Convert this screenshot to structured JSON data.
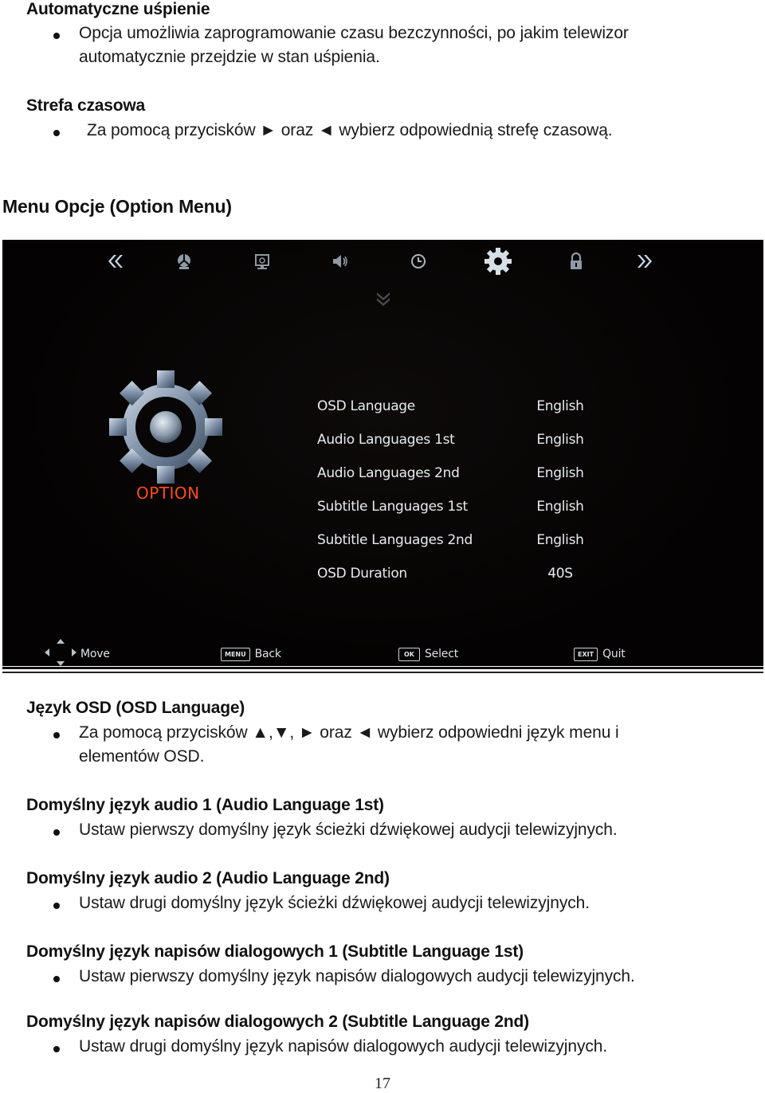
{
  "sections_top": [
    {
      "heading": "Automatyczne uśpienie",
      "bullets": [
        [
          "Opcja umożliwia zaprogramowanie czasu bezczynności, po jakim telewizor",
          "automatycznie przejdzie w stan uśpienia."
        ]
      ]
    },
    {
      "heading": "Strefa czasowa",
      "bullets": [
        [
          "Za pomocą przycisków ► oraz ◄ wybierz odpowiednią strefę czasową."
        ]
      ]
    }
  ],
  "menu_section_heading": "Menu Opcje (Option Menu)",
  "tv_screen": {
    "top_icons": [
      {
        "name": "prev-page",
        "glyph": "double-chevron-left-icon",
        "active": false
      },
      {
        "name": "channel",
        "glyph": "satellite-icon",
        "active": false
      },
      {
        "name": "picture",
        "glyph": "monitor-icon",
        "active": false
      },
      {
        "name": "sound",
        "glyph": "speaker-icon",
        "active": false
      },
      {
        "name": "time",
        "glyph": "clock-icon",
        "active": false
      },
      {
        "name": "option",
        "glyph": "gear-icon",
        "active": true
      },
      {
        "name": "lock",
        "glyph": "lock-icon",
        "active": false
      },
      {
        "name": "next-page",
        "glyph": "double-chevron-right-icon",
        "active": false
      }
    ],
    "section_label": "OPTION",
    "menu_items": [
      {
        "label": "OSD Language",
        "value": "English"
      },
      {
        "label": "Audio Languages 1st",
        "value": "English"
      },
      {
        "label": "Audio Languages 2nd",
        "value": "English"
      },
      {
        "label": "Subtitle Languages 1st",
        "value": "English"
      },
      {
        "label": "Subtitle Languages 2nd",
        "value": "English"
      },
      {
        "label": "OSD Duration",
        "value": "40S"
      }
    ],
    "hints": [
      {
        "key": "",
        "label": "Move"
      },
      {
        "key": "MENU",
        "label": "Back"
      },
      {
        "key": "OK",
        "label": "Select"
      },
      {
        "key": "EXIT",
        "label": "Quit"
      }
    ],
    "colors": {
      "background": "#050303",
      "text": "#e8ecef",
      "accent": "#ff4a1c",
      "icon_active": "#dde4ea",
      "icon_inactive": "#9aa6b0"
    }
  },
  "sections_bottom": [
    {
      "heading": "Język OSD (OSD Language)",
      "bullets": [
        [
          "Za pomocą przycisków ▲,▼, ► oraz ◄ wybierz odpowiedni język menu i",
          "elementów OSD."
        ]
      ]
    },
    {
      "heading": "Domyślny język audio 1 (Audio Language 1st)",
      "bullets": [
        [
          "Ustaw pierwszy domyślny język ścieżki dźwiękowej audycji telewizyjnych."
        ]
      ]
    },
    {
      "heading": "Domyślny język audio 2 (Audio Language 2nd)",
      "bullets": [
        [
          "Ustaw drugi domyślny język ścieżki dźwiękowej audycji telewizyjnych."
        ]
      ]
    },
    {
      "heading": "Domyślny język napisów dialogowych 1 (Subtitle Language 1st)",
      "bullets": [
        [
          "Ustaw pierwszy domyślny język napisów dialogowych audycji telewizyjnych."
        ]
      ]
    },
    {
      "heading": "Domyślny język napisów dialogowych 2 (Subtitle Language 2nd)",
      "bullets": [
        [
          "Ustaw drugi domyślny język napisów dialogowych audycji telewizyjnych."
        ]
      ]
    }
  ],
  "page_number": "17"
}
